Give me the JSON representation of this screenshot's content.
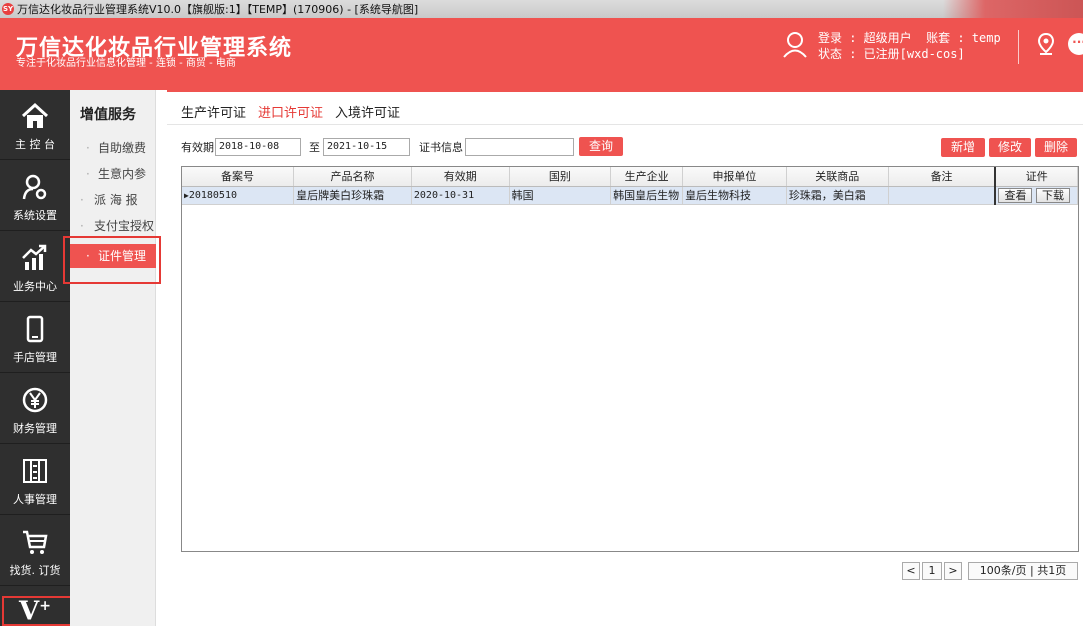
{
  "window": {
    "title": "万信达化妆品行业管理系统V10.0【旗舰版:1】【TEMP】(170906) - [系统导航图]",
    "app_icon": "SY"
  },
  "header": {
    "title": "万信达化妆品行业管理系统",
    "subtitle": "专注于化妆品行业信息化管理 - 连锁 - 商贸 - 电商",
    "login_line": "登录 : 超级用户  账套 : temp",
    "status_line": "状态 : 已注册[wxd-cos]",
    "more_glyph": "···"
  },
  "sidebar": {
    "items": [
      {
        "label": "主 控 台",
        "icon": "home-icon"
      },
      {
        "label": "系统设置",
        "icon": "user-settings-icon"
      },
      {
        "label": "业务中心",
        "icon": "chart-growth-icon"
      },
      {
        "label": "手店管理",
        "icon": "phone-icon"
      },
      {
        "label": "财务管理",
        "icon": "yen-icon"
      },
      {
        "label": "人事管理",
        "icon": "cabinet-icon"
      },
      {
        "label": "找货. 订货",
        "icon": "cart-icon"
      }
    ],
    "vplus_label": "V",
    "vplus_sup": "+"
  },
  "subnav": {
    "title": "增值服务",
    "items": [
      "自助缴费",
      "生意内参",
      "派 海 报",
      "支付宝授权",
      "证件管理"
    ],
    "active_index": 4
  },
  "tabs": [
    "生产许可证",
    "进口许可证",
    "入境许可证"
  ],
  "active_tab": 1,
  "filter": {
    "date_label": "有效期",
    "date_from": "2018-10-08",
    "to_label": "至",
    "date_to": "2021-10-15",
    "cert_label": "证书信息",
    "cert_value": "",
    "query_button": "查询"
  },
  "actions": {
    "add": "新增",
    "edit": "修改",
    "delete": "删除"
  },
  "table": {
    "columns": [
      "备案号",
      "产品名称",
      "有效期",
      "国别",
      "生产企业",
      "申报单位",
      "关联商品",
      "备注",
      "证件"
    ],
    "rows": [
      {
        "indicator": "▶",
        "cells": [
          "20180510",
          "皇后牌美白珍珠霜",
          "2020-10-31",
          "韩国",
          "韩国皇后生物",
          "皇后生物科技",
          "珍珠霜，美白霜",
          ""
        ],
        "view_button": "查看",
        "download_button": "下载"
      }
    ]
  },
  "pager": {
    "prev": "<",
    "page": "1",
    "next": ">",
    "summary": "100条/页 | 共1页"
  },
  "colors": {
    "accent": "#ef5350",
    "sidebar_bg": "#2f2f2f",
    "row_selected": "#dce6f4"
  }
}
